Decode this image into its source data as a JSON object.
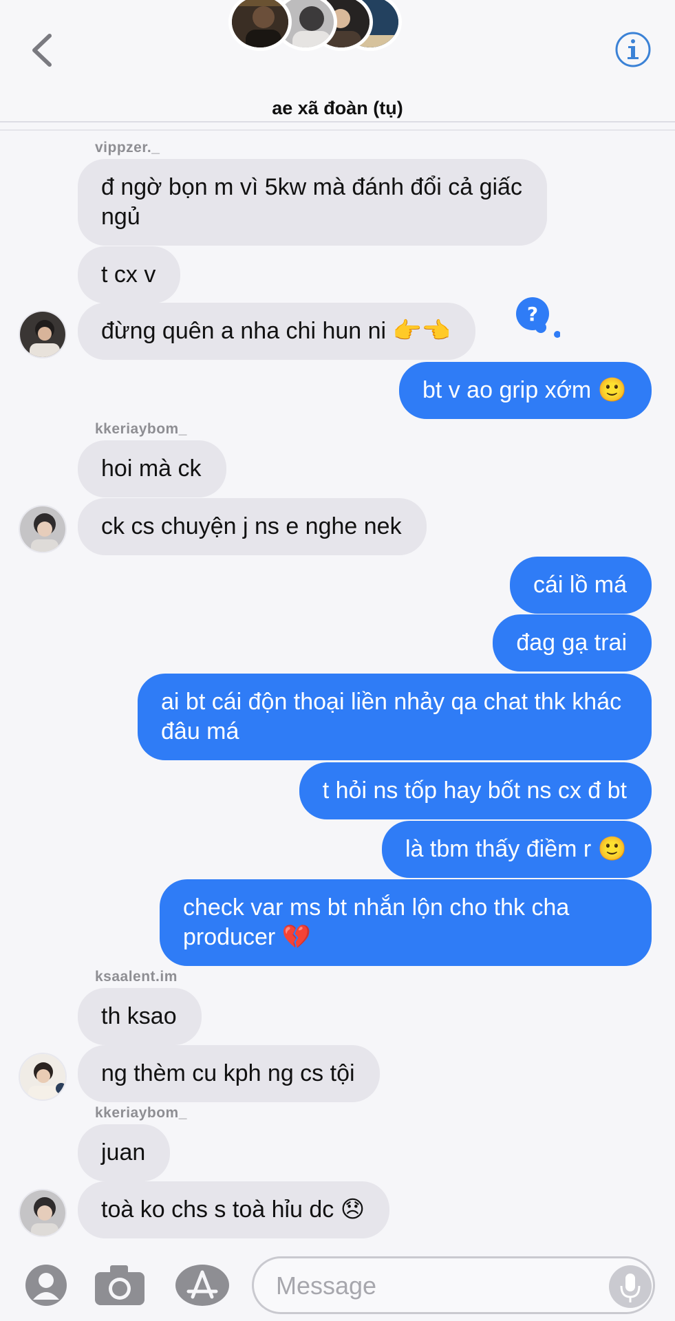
{
  "header": {
    "title": "ae xã đoàn (tụ)"
  },
  "messages": [
    {
      "sender": "vippzer._"
    },
    {
      "text": "đ ngờ bọn m vì 5kw mà đánh đổi cả giấc ngủ"
    },
    {
      "text": "t cx v"
    },
    {
      "text": "đừng quên a nha chi hun ni 👉👈"
    },
    {
      "text": "bt v ao grip xớm 🙂"
    },
    {
      "sender": "kkeriaybom_"
    },
    {
      "text": "hoi mà ck"
    },
    {
      "text": "ck cs chuyện j ns e nghe nek"
    },
    {
      "text": "cái lồ má"
    },
    {
      "text": "đag gạ trai"
    },
    {
      "text": "ai bt cái độn thoại liền nhảy qa chat thk khác đâu má"
    },
    {
      "text": "t hỏi ns tốp hay bốt ns cx đ bt"
    },
    {
      "text": "là tbm thấy điềm r 🙂"
    },
    {
      "text": "check var ms bt nhắn lộn cho thk cha producer 💔"
    },
    {
      "sender": "ksaalent.im"
    },
    {
      "text": "th ksao"
    },
    {
      "text": "ng thèm cu kph ng cs tội"
    },
    {
      "sender": "kkeriaybom_"
    },
    {
      "text": "juan"
    },
    {
      "text": "toà ko chs s toà hỉu dc 😞"
    }
  ],
  "composer": {
    "placeholder": "Message"
  },
  "colors": {
    "outgoing": "#2f7cf6",
    "incoming": "#e6e5eb",
    "accent": "#3b82d6"
  },
  "icons": [
    "back-chevron-icon",
    "info-icon",
    "person-icon",
    "camera-icon",
    "app-store-icon",
    "mic-icon"
  ]
}
